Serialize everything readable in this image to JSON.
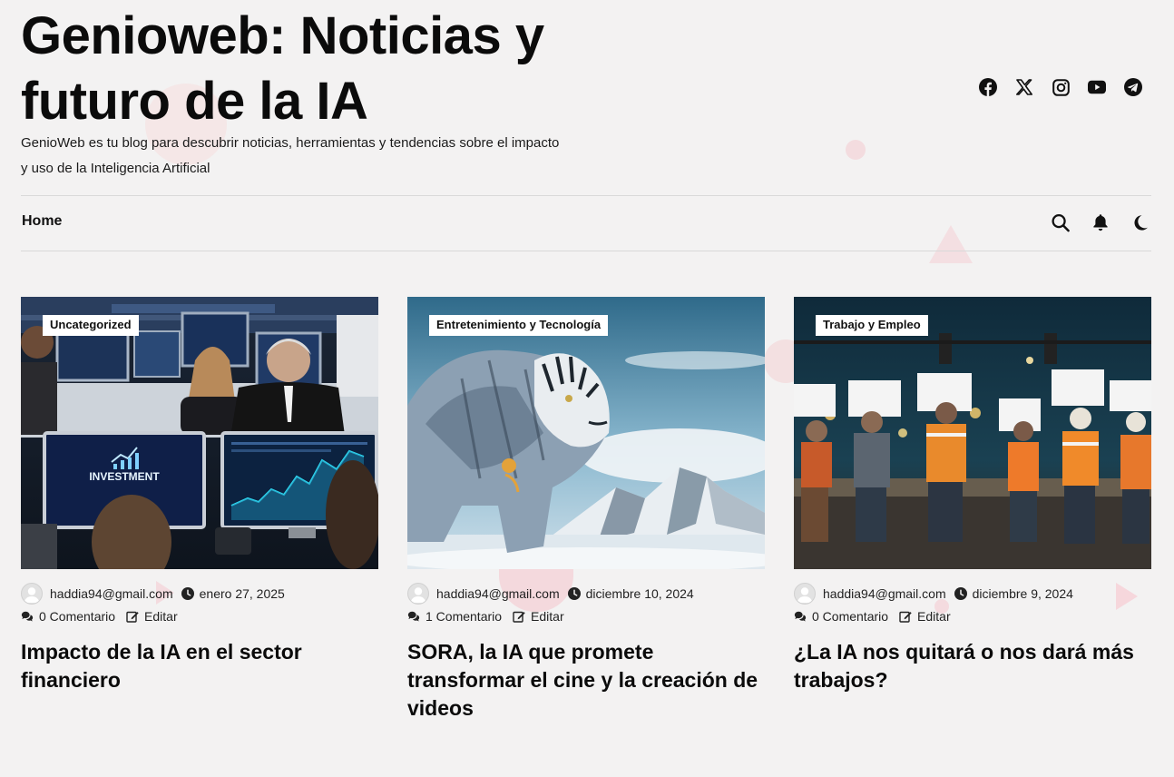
{
  "site": {
    "title": "Genioweb: Noticias y futuro de la IA",
    "description": "GenioWeb es tu blog para descubrir noticias, herramientas y tendencias sobre el impacto y uso de la Inteligencia Artificial"
  },
  "social": [
    "facebook-icon",
    "x-icon",
    "instagram-icon",
    "youtube-icon",
    "telegram-icon"
  ],
  "nav": {
    "home_label": "Home",
    "tools": [
      "search-icon",
      "bell-icon",
      "moon-icon"
    ]
  },
  "posts": [
    {
      "category": "Uncategorized",
      "author": "haddia94@gmail.com",
      "date": "enero 27, 2025",
      "comments": "0 Comentario",
      "edit": "Editar",
      "title": "Impacto de la IA en el sector financiero",
      "image_text": "INVESTMENT"
    },
    {
      "category": "Entretenimiento y Tecnología",
      "author": "haddia94@gmail.com",
      "date": "diciembre 10, 2024",
      "comments": "1 Comentario",
      "edit": "Editar",
      "title": "SORA, la IA que promete transformar el cine y la creación de videos"
    },
    {
      "category": "Trabajo y Empleo",
      "author": "haddia94@gmail.com",
      "date": "diciembre 9, 2024",
      "comments": "0 Comentario",
      "edit": "Editar",
      "title": "¿La IA nos quitará o nos dará más trabajos?"
    }
  ],
  "colors": {
    "background": "#f3f2f2",
    "text": "#111111",
    "accent_shapes": "#f4d3d6"
  }
}
